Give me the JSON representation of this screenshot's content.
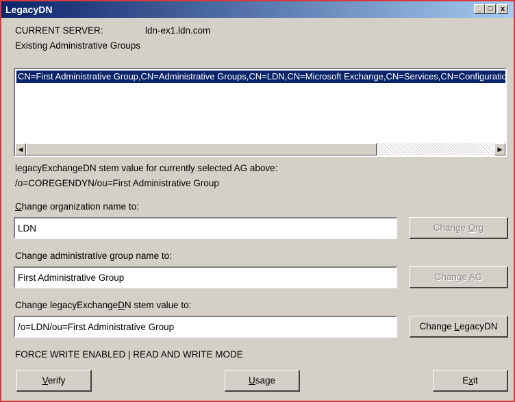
{
  "window": {
    "title": "LegacyDN",
    "controls": {
      "minimize": "_",
      "maximize": "□",
      "close": "x"
    }
  },
  "server": {
    "label": "CURRENT SERVER:",
    "value": "ldn-ex1.ldn.com"
  },
  "groups": {
    "label": "Existing Administrative Groups",
    "items": [
      "CN=First Administrative Group,CN=Administrative Groups,CN=LDN,CN=Microsoft Exchange,CN=Services,CN=Configuration,DC=ldn,DC=com"
    ]
  },
  "stem": {
    "label": "legacyExchangeDN stem value for currently selected AG above:",
    "value": "/o=COREGENDYN/ou=First Administrative Group"
  },
  "org": {
    "label_pre": "",
    "label_key": "C",
    "label_post": "hange organization name to:",
    "value": "LDN",
    "button_pre": "Change ",
    "button_key": "O",
    "button_post": "rg"
  },
  "ag": {
    "label": "Change administrative group name to:",
    "value": "First Administrative Group",
    "button_pre": "Change ",
    "button_key": "A",
    "button_post": "G"
  },
  "legacy": {
    "label_pre": "Change legacyExchange",
    "label_key": "D",
    "label_post": "N stem value to:",
    "value": "/o=LDN/ou=First Administrative Group",
    "button_pre": "Change ",
    "button_key": "L",
    "button_post": "egacyDN"
  },
  "status": "FORCE WRITE ENABLED | READ AND WRITE MODE",
  "buttons": {
    "verify": {
      "pre": "",
      "key": "V",
      "post": "erify"
    },
    "usage": {
      "pre": "",
      "key": "U",
      "post": "sage"
    },
    "exit": {
      "pre": "E",
      "key": "x",
      "post": "it"
    }
  }
}
